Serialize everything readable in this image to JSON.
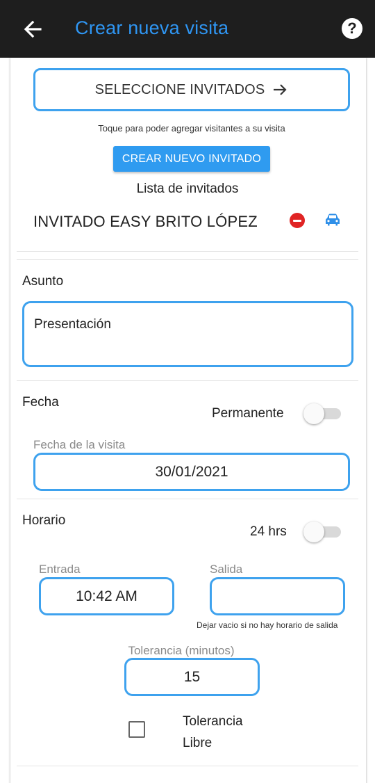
{
  "appbar": {
    "title": "Crear nueva visita",
    "back_icon": "arrow-back-icon",
    "help_icon": "help-icon",
    "help_label": "?"
  },
  "guests": {
    "select_label": "SELECCIONE INVITADOS",
    "hint": "Toque para poder agregar visitantes a su visita",
    "new_guest_label": "CREAR NUEVO INVITADO",
    "list_title": "Lista de invitados",
    "items": [
      {
        "name": "INVITADO EASY BRITO LÓPEZ"
      }
    ]
  },
  "subject": {
    "label": "Asunto",
    "value": "Presentación"
  },
  "date": {
    "label": "Fecha",
    "permanent_label": "Permanente",
    "permanent_on": false,
    "visit_date_label": "Fecha de la visita",
    "visit_date_value": "30/01/2021"
  },
  "schedule": {
    "label": "Horario",
    "hours24_label": "24 hrs",
    "hours24_on": false,
    "entry_label": "Entrada",
    "entry_value": "10:42 AM",
    "exit_label": "Salida",
    "exit_value": "",
    "exit_hint": "Dejar vacio si no hay horario de salida",
    "tolerance_label": "Tolerancia (minutos)",
    "tolerance_value": "15",
    "free_tolerance_label_1": "Tolerancia",
    "free_tolerance_label_2": "Libre",
    "free_tolerance_checked": false
  },
  "colors": {
    "accent": "#3ea2ee",
    "appbar": "#1e1e1e",
    "title": "#2f96f3",
    "button": "#2f9bf0",
    "remove": "#e02424",
    "car": "#2f8fe8"
  }
}
